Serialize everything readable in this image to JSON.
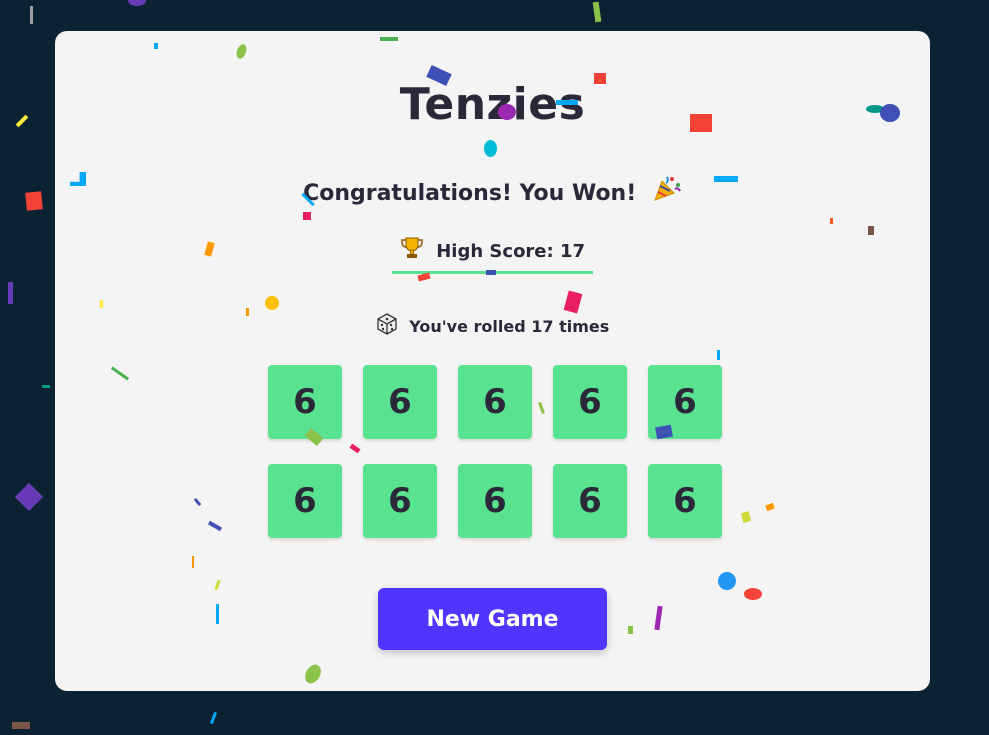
{
  "title": "Tenzies",
  "status": {
    "message": "Congratulations! You Won!",
    "message_icon": "party-popper-icon"
  },
  "high_score": {
    "icon": "trophy-icon",
    "text": "High Score: 17"
  },
  "rolls": {
    "icon": "dice-icon",
    "text": "You've rolled 17 times"
  },
  "dice": [
    "6",
    "6",
    "6",
    "6",
    "6",
    "6",
    "6",
    "6",
    "6",
    "6"
  ],
  "new_game_label": "New Game",
  "colors": {
    "background": "#0b2233",
    "card": "#f4f4f4",
    "die": "#59e391",
    "button": "#5035ff",
    "text": "#2b283a"
  }
}
